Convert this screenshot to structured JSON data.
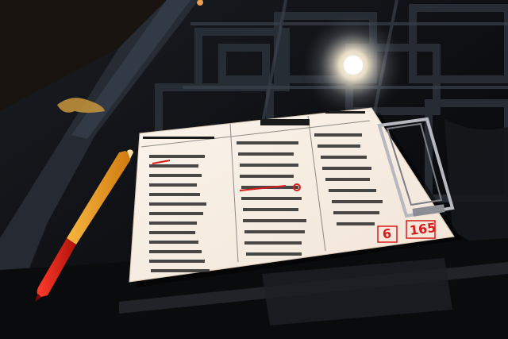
{
  "scene": {
    "description_tags": [
      "glass-table",
      "order-sheet",
      "clipboard",
      "marker-pen",
      "lamp-reflection"
    ],
    "colors": {
      "table_dark": "#0d0d10",
      "glass_sheen": "#1c2430",
      "paper": "#f7efe6",
      "ink": "#1a1a1a",
      "handwriting_red": "#d81b1b",
      "marker_orange": "#f0a020",
      "clip_metal": "#b8b8c0",
      "lamp_glow": "#fff6e0"
    }
  },
  "order_sheet": {
    "handwritten_table_number": "6",
    "handwritten_total": "165"
  }
}
